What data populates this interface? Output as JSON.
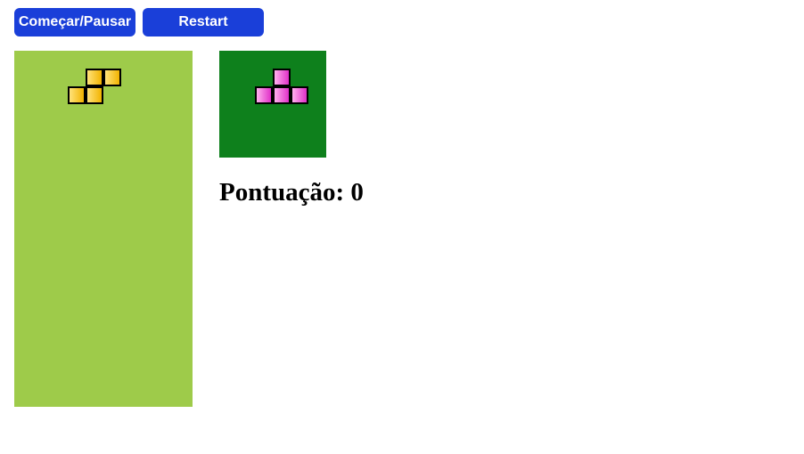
{
  "controls": {
    "start_pause_label": "Começar/Pausar",
    "restart_label": "Restart",
    "button_color": "#1a3fd9"
  },
  "board": {
    "background": "#9ecb4a",
    "columns": 10,
    "rows": 20,
    "current_piece": {
      "shape": "S",
      "colors": [
        "#ffe27a",
        "#f2b300"
      ],
      "cells": [
        [
          4,
          1
        ],
        [
          5,
          1
        ],
        [
          3,
          2
        ],
        [
          4,
          2
        ]
      ]
    }
  },
  "next_preview": {
    "background": "#0e801c",
    "piece": {
      "shape": "T",
      "colors": [
        "#ffb0ee",
        "#e030c8"
      ],
      "cells": [
        [
          3,
          1
        ],
        [
          2,
          2
        ],
        [
          3,
          2
        ],
        [
          4,
          2
        ]
      ]
    }
  },
  "score": {
    "text": "Pontuação: 0"
  }
}
